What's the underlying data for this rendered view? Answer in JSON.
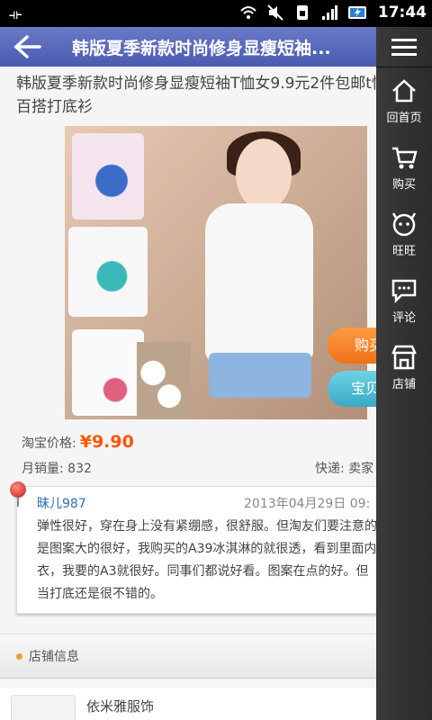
{
  "status_bar": {
    "time": "17:44",
    "icons": [
      "usb-icon",
      "wifi-icon",
      "mute-icon",
      "sim-icon",
      "signal-icon",
      "battery-icon"
    ]
  },
  "header": {
    "title": "韩版夏季新款时尚修身显瘦短袖..."
  },
  "sidenav": {
    "items": [
      {
        "label": "回首页",
        "icon": "home-icon"
      },
      {
        "label": "购买",
        "icon": "cart-icon"
      },
      {
        "label": "旺旺",
        "icon": "chat-face-icon"
      },
      {
        "label": "评论",
        "icon": "comment-icon"
      },
      {
        "label": "店铺",
        "icon": "shop-icon"
      }
    ]
  },
  "product": {
    "title": "韩版夏季新款时尚修身显瘦短袖T恤女9.9元2件包邮t恤百搭打底衫",
    "price_label": "淘宝价格:",
    "price": "¥9.90",
    "sales_label": "月销量:",
    "sales": "832",
    "express_label": "快递:",
    "express_value": "卖家",
    "buy_button": "购买",
    "fav_button": "宝贝"
  },
  "review": {
    "user": "昧儿987",
    "date": "2013年04月29日 09:",
    "text": "弹性很好，穿在身上没有紧绷感，很舒服。但淘友们要注意的是图案大的很好，我购买的A39冰淇淋的就很透，看到里面内衣，我要的A3就很好。同事们都说好看。图案在点的好。但当打底还是很不错的。"
  },
  "shop": {
    "section_label": "店铺信息",
    "name": "依米雅服饰"
  },
  "colors": {
    "header": "#5566bb",
    "accent": "#ff5500",
    "sidenav": "#333333"
  }
}
